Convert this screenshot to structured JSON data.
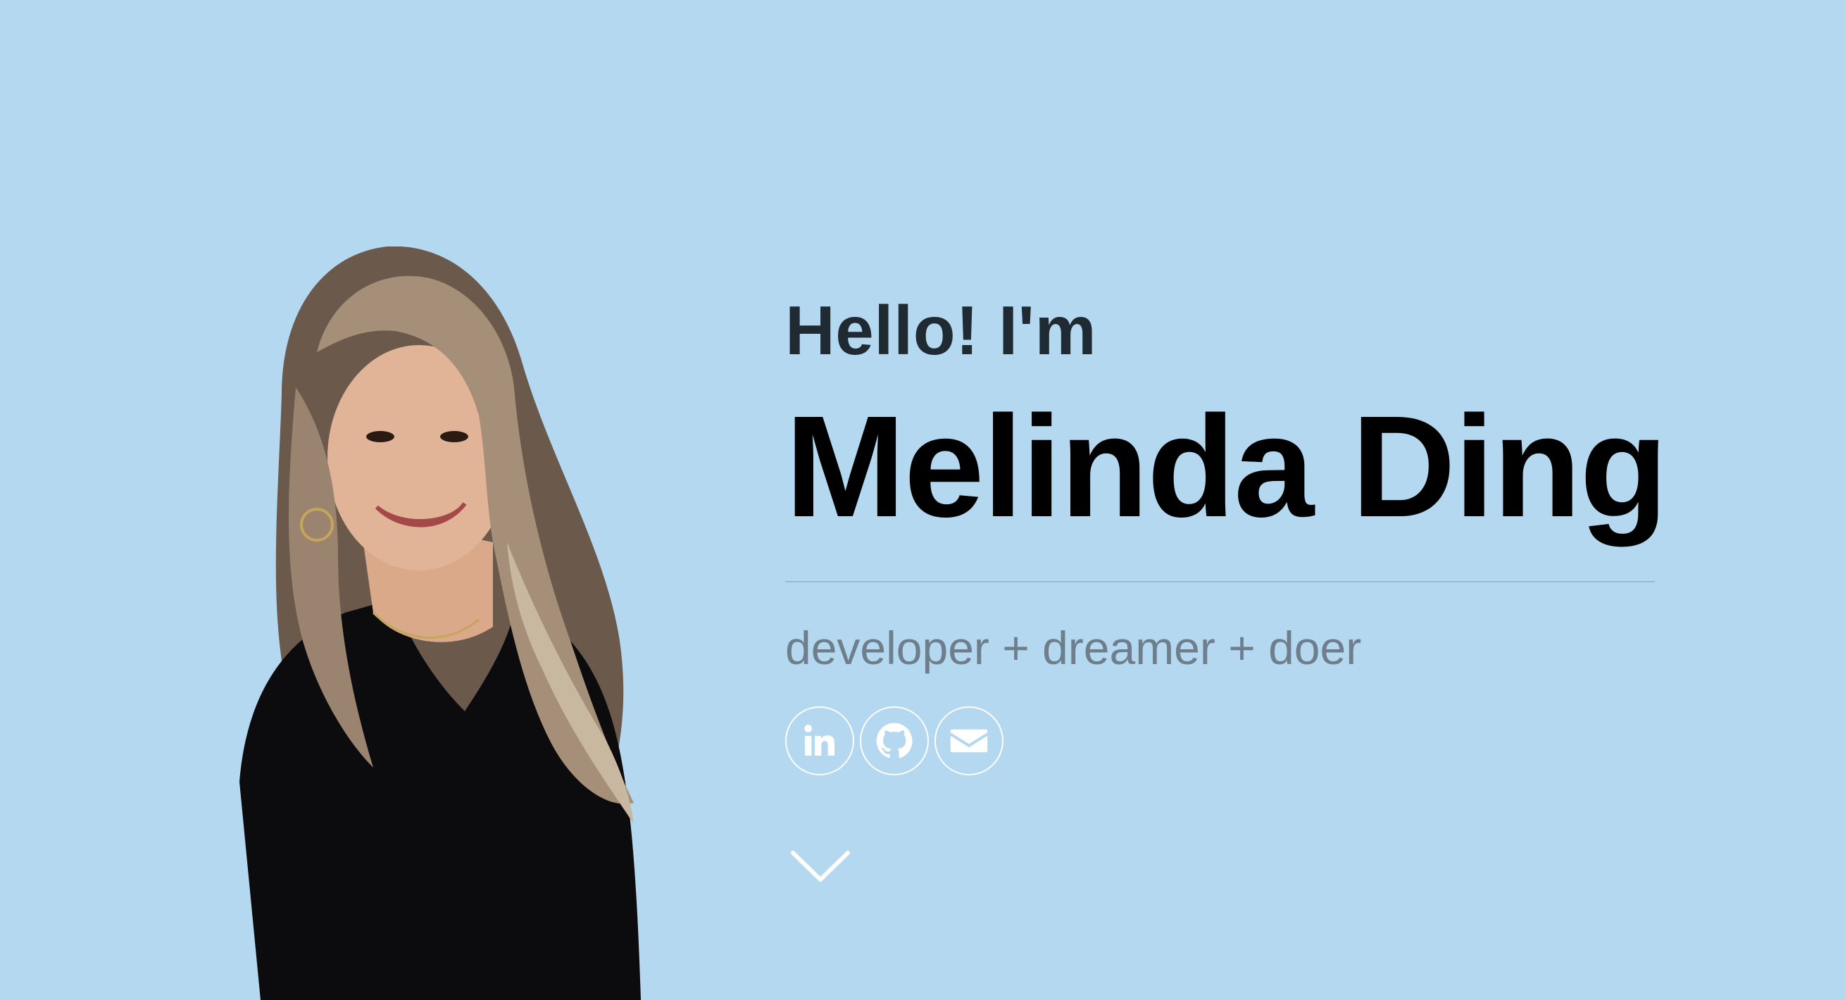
{
  "hero": {
    "greeting": "Hello! I'm",
    "name": "Melinda Ding",
    "tagline": "developer + dreamer + doer"
  },
  "social": [
    {
      "icon": "linkedin-icon",
      "label": "LinkedIn"
    },
    {
      "icon": "github-icon",
      "label": "GitHub"
    },
    {
      "icon": "email-icon",
      "label": "Email"
    }
  ],
  "colors": {
    "background": "#b3d8ef",
    "greeting": "#1f2a33",
    "name": "#000000",
    "tagline": "#6f7e8c",
    "icon": "#ffffff"
  }
}
